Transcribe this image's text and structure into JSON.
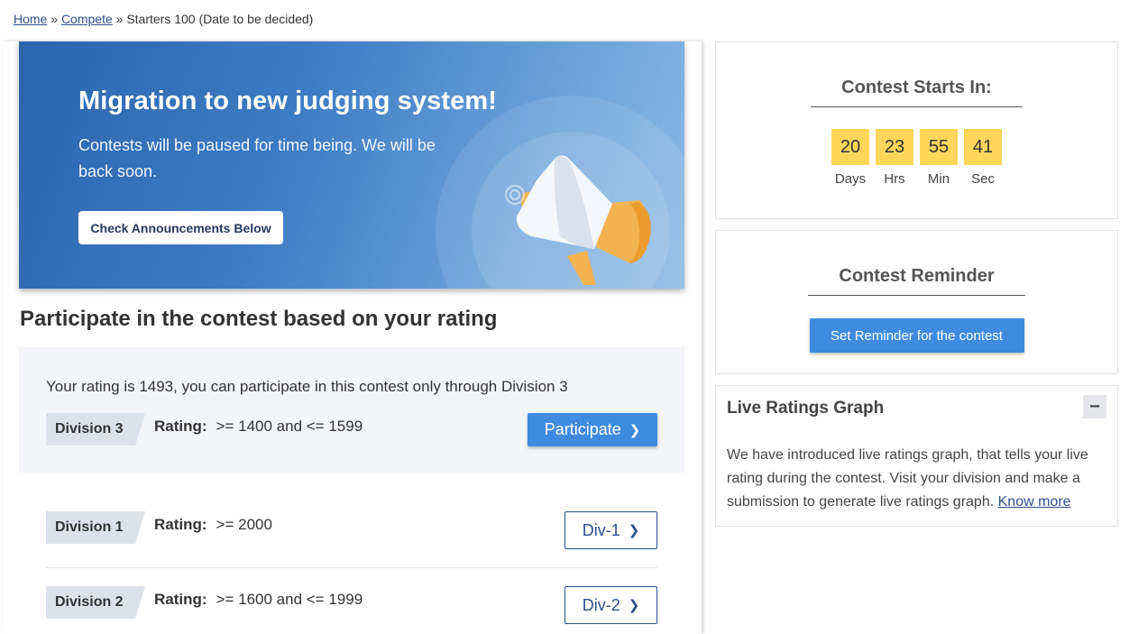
{
  "breadcrumb": {
    "home": "Home",
    "sep1": "»",
    "compete": "Compete",
    "sep2": "»",
    "current": "Starters 100 (Date to be decided)"
  },
  "banner": {
    "title": "Migration to new judging system!",
    "text": "Contests will be paused for time being. We will be back soon.",
    "button": "Check Announcements Below"
  },
  "main": {
    "section_title": "Participate in the contest based on your rating",
    "rating_message": "Your rating is 1493, you can participate in this contest only through Division 3",
    "rating_prefix": "Rating:",
    "divisions": [
      {
        "tag": "Division 3",
        "range": ">= 1400 and <= 1599",
        "button": "Participate"
      },
      {
        "tag": "Division 1",
        "range": ">= 2000",
        "button": "Div-1"
      },
      {
        "tag": "Division 2",
        "range": ">= 1600 and <= 1999",
        "button": "Div-2"
      }
    ]
  },
  "countdown": {
    "title": "Contest Starts In:",
    "units": [
      {
        "value": "20",
        "label": "Days"
      },
      {
        "value": "23",
        "label": "Hrs"
      },
      {
        "value": "55",
        "label": "Min"
      },
      {
        "value": "41",
        "label": "Sec"
      }
    ]
  },
  "reminder": {
    "title": "Contest Reminder",
    "button": "Set Reminder for the contest"
  },
  "live_graph": {
    "title": "Live Ratings Graph",
    "collapse": "−",
    "text": "We have introduced live ratings graph, that tells your live rating during the contest. Visit your division and make a submission to generate live ratings graph.",
    "link": "Know more"
  },
  "colors": {
    "primary_button": "#3f8be0",
    "countdown_box": "#ffd65a",
    "link": "#2c4f8c",
    "banner_blue": "#2b65ac"
  }
}
